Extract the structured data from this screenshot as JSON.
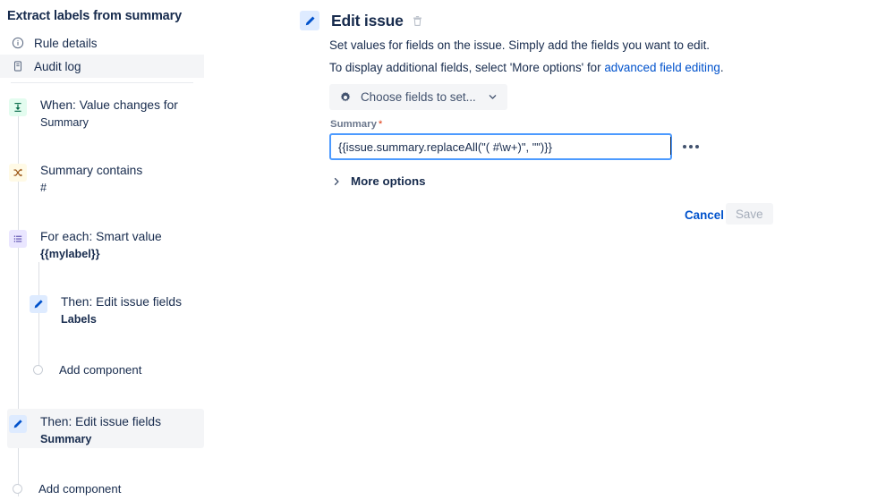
{
  "sidebar": {
    "rule_title": "Extract labels from summary",
    "nav": [
      {
        "label": "Rule details",
        "icon": "info-circle-icon",
        "selected": false
      },
      {
        "label": "Audit log",
        "icon": "document-icon",
        "selected": true
      }
    ],
    "components": [
      {
        "title": "When: Value changes for",
        "sub": "Summary",
        "icon": "trigger-icon",
        "kind": "trigger"
      },
      {
        "title": "Summary contains",
        "sub": "#",
        "icon": "condition-shuffle-icon",
        "kind": "condition"
      },
      {
        "title": "For each: Smart value",
        "sub": "{{mylabel}}",
        "icon": "branch-list-icon",
        "kind": "branch"
      },
      {
        "title": "Then: Edit issue fields",
        "sub": "Labels",
        "icon": "pencil-icon",
        "kind": "action"
      },
      {
        "title": "Then: Edit issue fields",
        "sub": "Summary",
        "icon": "pencil-icon",
        "kind": "action"
      }
    ],
    "add_component_label": "Add component",
    "add_component_label_2": "Add component"
  },
  "main": {
    "title": "Edit issue",
    "delete_icon": "trash-icon",
    "header_icon": "pencil-icon",
    "description_line1": "Set values for fields on the issue. Simply add the fields you want to edit.",
    "description_line2_prefix": "To display additional fields, select 'More options' for ",
    "description_link": "advanced field editing",
    "description_line2_suffix": ".",
    "choose_fields_label": "Choose fields to set...",
    "choose_fields_icon": "gear-icon",
    "choose_fields_chevron": "chevron-down-icon",
    "field_label": "Summary",
    "field_required_mark": "*",
    "field_value": "{{issue.summary.replaceAll(\"( #\\w+)\", \"\")}}",
    "field_placeholder": "",
    "more_menu_icon": "ellipsis-icon",
    "more_options_label": "More options",
    "more_options_icon": "chevron-right-icon",
    "cancel_label": "Cancel",
    "save_label": "Save"
  },
  "colors": {
    "accent": "#0052cc",
    "focus_border": "#4c9aff",
    "text": "#172b4d",
    "subtle_text": "#6b778c",
    "required": "#de350b",
    "trigger_bg": "#e3fcef",
    "condition_bg": "#fffae6",
    "branch_bg": "#eae6ff",
    "action_bg": "#deebff",
    "selected_bg": "#f4f5f7"
  }
}
